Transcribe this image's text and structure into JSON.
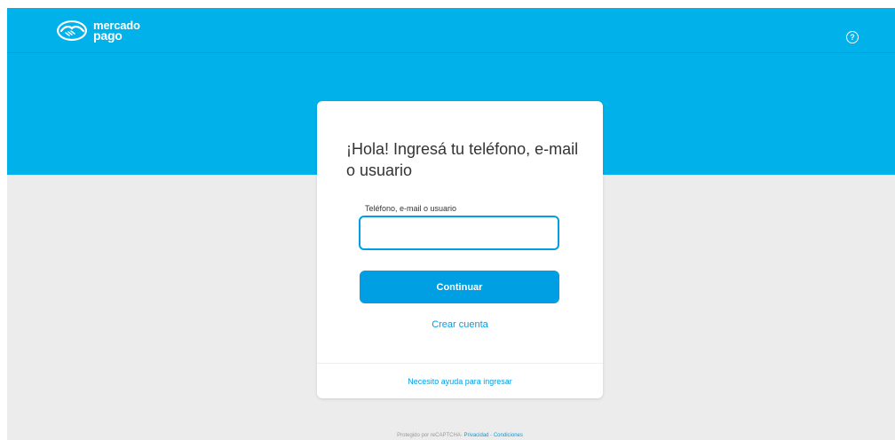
{
  "header": {
    "logo_line1": "mercado",
    "logo_line2": "pago",
    "help_symbol": "?"
  },
  "login": {
    "title": "¡Hola! Ingresá tu teléfono, e-mail o usuario",
    "field_label": "Teléfono, e-mail o usuario",
    "field_value": "",
    "continue_label": "Continuar",
    "create_account_label": "Crear cuenta",
    "help_label": "Necesito ayuda para ingresar"
  },
  "footer": {
    "recaptcha_text": "Protegido por reCAPTCHA-",
    "privacy_label": "Privacidad",
    "separator": "-",
    "terms_label": "Condiciones"
  },
  "colors": {
    "brand_blue": "#00b1ea",
    "action_blue": "#009ee3",
    "background_gray": "#ececec"
  },
  "icons": {
    "logo": "handshake-icon",
    "help": "question-circle-icon"
  }
}
